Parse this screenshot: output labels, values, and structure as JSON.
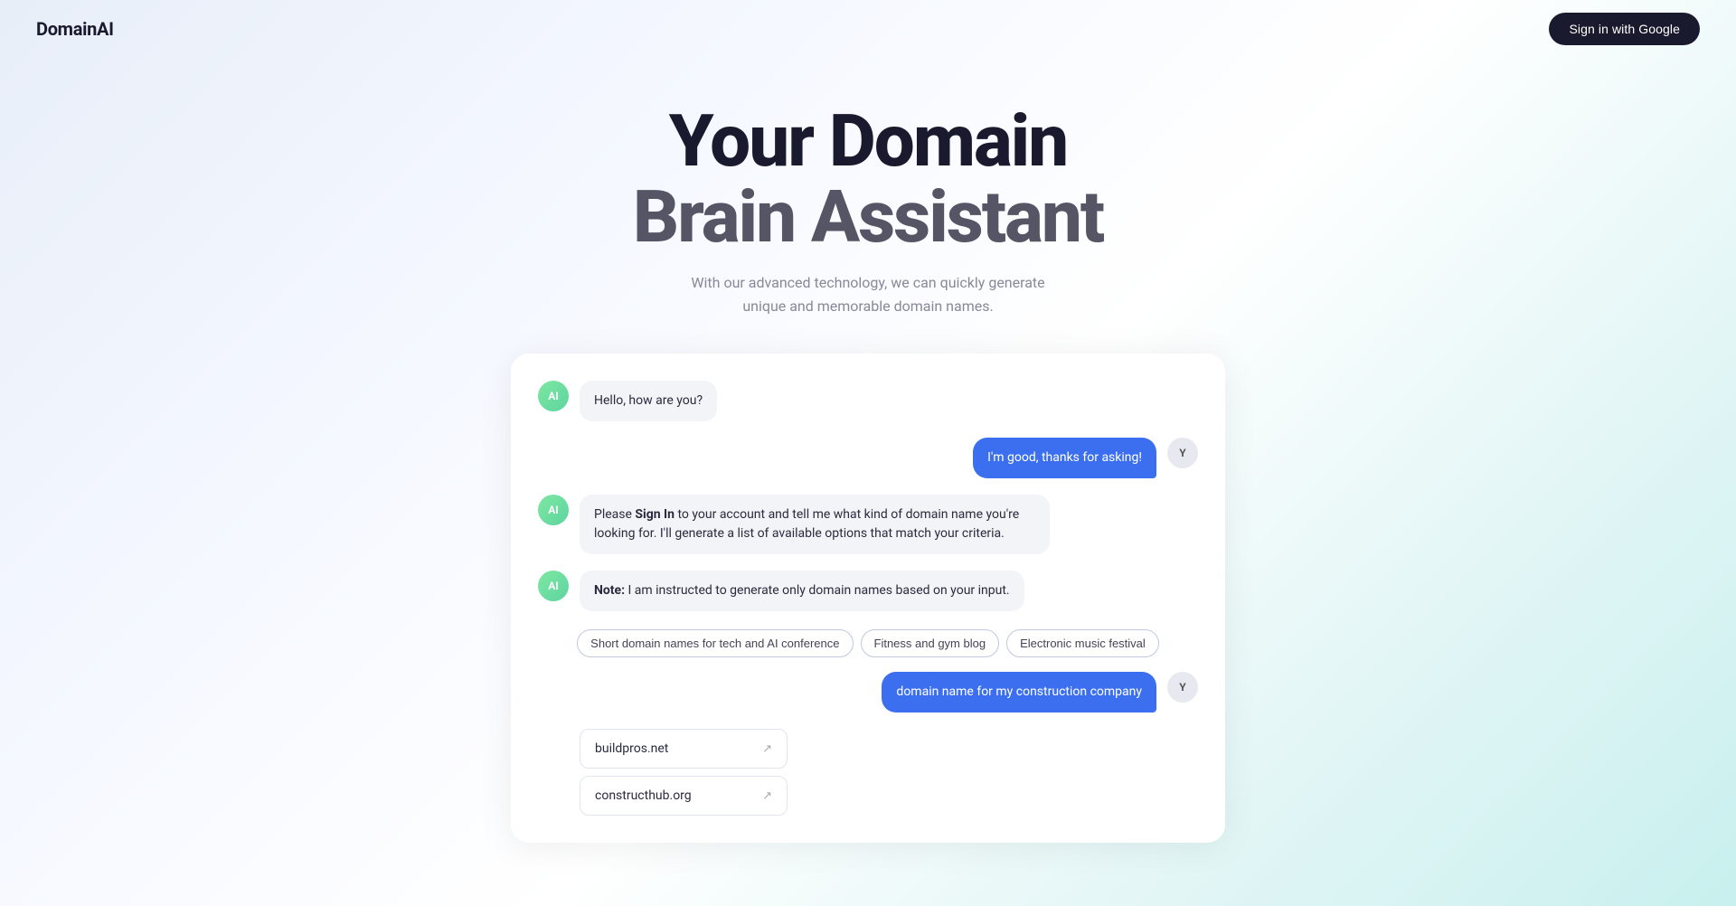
{
  "header": {
    "logo": "DomainAI",
    "sign_in_label": "Sign in with Google"
  },
  "hero": {
    "title_line1": "Your Domain",
    "title_line2": "Brain Assistant",
    "subtitle": "With our advanced technology, we can quickly generate unique and memorable domain names."
  },
  "chat": {
    "ai_avatar_label": "AI",
    "user_avatar_label": "Y",
    "messages": [
      {
        "role": "ai",
        "text": "Hello, how are you?"
      },
      {
        "role": "user",
        "text": "I'm good, thanks for asking!"
      },
      {
        "role": "ai",
        "text_html": "Please <strong>Sign In</strong> to your account and tell me what kind of domain name you're looking for. I'll generate a list of available options that match your criteria."
      },
      {
        "role": "ai",
        "text_html": "<strong>Note:</strong> I am instructed to generate only domain names based on your input."
      }
    ],
    "suggestions": [
      "Short domain names for tech and AI conference",
      "Fitness and gym blog",
      "Electronic music festival"
    ],
    "user_query": "domain name for my construction company",
    "domain_results": [
      "buildpros.net",
      "constructhub.org"
    ]
  }
}
